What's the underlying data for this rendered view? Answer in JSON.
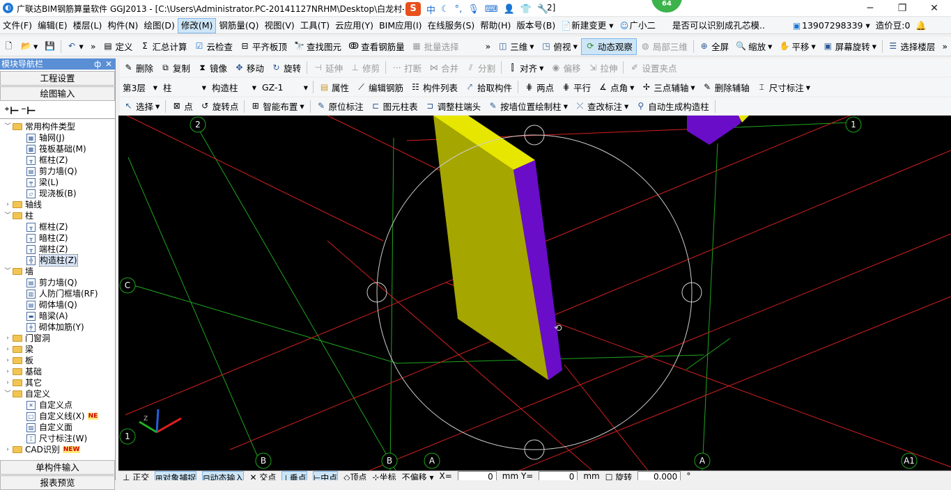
{
  "title_bar": {
    "app_icon": "glodon-logo-icon",
    "title": "广联达BIM钢筋算量软件 GGJ2013 - [C:\\Users\\Administrator.PC-20141127NRHM\\Desktop\\白龙村-",
    "title_tail": "2]",
    "badge": "64",
    "ime": {
      "mode": "中"
    }
  },
  "menu": [
    "文件(F)",
    "编辑(E)",
    "楼层(L)",
    "构件(N)",
    "绘图(D)",
    "修改(M)",
    "钢筋量(Q)",
    "视图(V)",
    "工具(T)",
    "云应用(Y)",
    "BIM应用(I)",
    "在线服务(S)",
    "帮助(H)",
    "版本号(B)",
    "新建变更",
    "广小二",
    "是否可以识别成孔芯模..",
    "13907298339",
    "造价豆:0"
  ],
  "toolbar1": {
    "items": [
      "定义",
      "汇总计算",
      "云检查",
      "平齐板顶",
      "查找图元",
      "查看钢筋量",
      "批量选择",
      "三维",
      "俯视",
      "动态观察",
      "局部三维",
      "全屏",
      "缩放",
      "平移",
      "屏幕旋转",
      "选择楼层"
    ],
    "overflow": "»"
  },
  "left_panel": {
    "header": "模块导航栏",
    "pin": "ф",
    "close": "✕",
    "btn_project": "工程设置",
    "btn_draw": "绘图输入",
    "btn_single": "单构件输入",
    "btn_report": "报表预览",
    "tree": [
      {
        "l": "常用构件类型",
        "d": 0,
        "t": "folder",
        "e": "﹀"
      },
      {
        "l": "轴网(J)",
        "d": 1,
        "t": "item"
      },
      {
        "l": "筏板基础(M)",
        "d": 1,
        "t": "item"
      },
      {
        "l": "框柱(Z)",
        "d": 1,
        "t": "item"
      },
      {
        "l": "剪力墙(Q)",
        "d": 1,
        "t": "item"
      },
      {
        "l": "梁(L)",
        "d": 1,
        "t": "item"
      },
      {
        "l": "现浇板(B)",
        "d": 1,
        "t": "item"
      },
      {
        "l": "轴线",
        "d": 0,
        "t": "folder",
        "e": "›"
      },
      {
        "l": "柱",
        "d": 0,
        "t": "folder",
        "e": "﹀"
      },
      {
        "l": "框柱(Z)",
        "d": 1,
        "t": "item"
      },
      {
        "l": "暗柱(Z)",
        "d": 1,
        "t": "item"
      },
      {
        "l": "端柱(Z)",
        "d": 1,
        "t": "item"
      },
      {
        "l": "构造柱(Z)",
        "d": 1,
        "t": "item",
        "sel": true
      },
      {
        "l": "墙",
        "d": 0,
        "t": "folder",
        "e": "﹀"
      },
      {
        "l": "剪力墙(Q)",
        "d": 1,
        "t": "item"
      },
      {
        "l": "人防门框墙(RF)",
        "d": 1,
        "t": "item"
      },
      {
        "l": "砌体墙(Q)",
        "d": 1,
        "t": "item"
      },
      {
        "l": "暗梁(A)",
        "d": 1,
        "t": "item"
      },
      {
        "l": "砌体加筋(Y)",
        "d": 1,
        "t": "item"
      },
      {
        "l": "门窗洞",
        "d": 0,
        "t": "folder",
        "e": "›"
      },
      {
        "l": "梁",
        "d": 0,
        "t": "folder",
        "e": "›"
      },
      {
        "l": "板",
        "d": 0,
        "t": "folder",
        "e": "›"
      },
      {
        "l": "基础",
        "d": 0,
        "t": "folder",
        "e": "›"
      },
      {
        "l": "其它",
        "d": 0,
        "t": "folder",
        "e": "›"
      },
      {
        "l": "自定义",
        "d": 0,
        "t": "folder",
        "e": "﹀"
      },
      {
        "l": "自定义点",
        "d": 1,
        "t": "item"
      },
      {
        "l": "自定义线(X)",
        "d": 1,
        "t": "item",
        "new": "NE"
      },
      {
        "l": "自定义面",
        "d": 1,
        "t": "item"
      },
      {
        "l": "尺寸标注(W)",
        "d": 1,
        "t": "item"
      },
      {
        "l": "CAD识别",
        "d": 0,
        "t": "folder",
        "e": "›",
        "new": "NEW"
      }
    ]
  },
  "toolbar_edit": [
    "删除",
    "复制",
    "镜像",
    "移动",
    "旋转",
    "延伸",
    "修剪",
    "打断",
    "合并",
    "分割",
    "对齐",
    "偏移",
    "拉伸",
    "设置夹点"
  ],
  "toolbar_props": {
    "floor": "第3层",
    "category": "柱",
    "type": "构造柱",
    "name": "GZ-1",
    "items": [
      "属性",
      "编辑钢筋",
      "构件列表",
      "拾取构件",
      "两点",
      "平行",
      "点角",
      "三点辅轴",
      "删除辅轴",
      "尺寸标注"
    ]
  },
  "toolbar_draw": [
    "选择",
    "点",
    "旋转点",
    "智能布置",
    "原位标注",
    "图元柱表",
    "调整柱端头",
    "按墙位置绘制柱",
    "查改标注",
    "自动生成构造柱"
  ],
  "axis_labels": [
    "2",
    "1",
    "C",
    "1",
    "B",
    "B",
    "A",
    "A",
    "A1"
  ],
  "status": {
    "items": [
      "正交",
      "对象捕捉",
      "动态输入",
      "交点",
      "垂点",
      "中点",
      "顶点",
      "坐标",
      "不偏移"
    ],
    "x_label": "X=",
    "x_val": "0",
    "y_label": "mm Y=",
    "y_val": "0",
    "unit": "mm",
    "rot_label": "旋转",
    "rot_val": "0.000",
    "deg": "°"
  },
  "colors": {
    "column_face": "#a6a600",
    "column_top": "#e6e600",
    "column_side": "#6a0dc9",
    "grid_green": "#1fa51f",
    "grid_red": "#d42020",
    "orbit": "#cfcfcf"
  }
}
